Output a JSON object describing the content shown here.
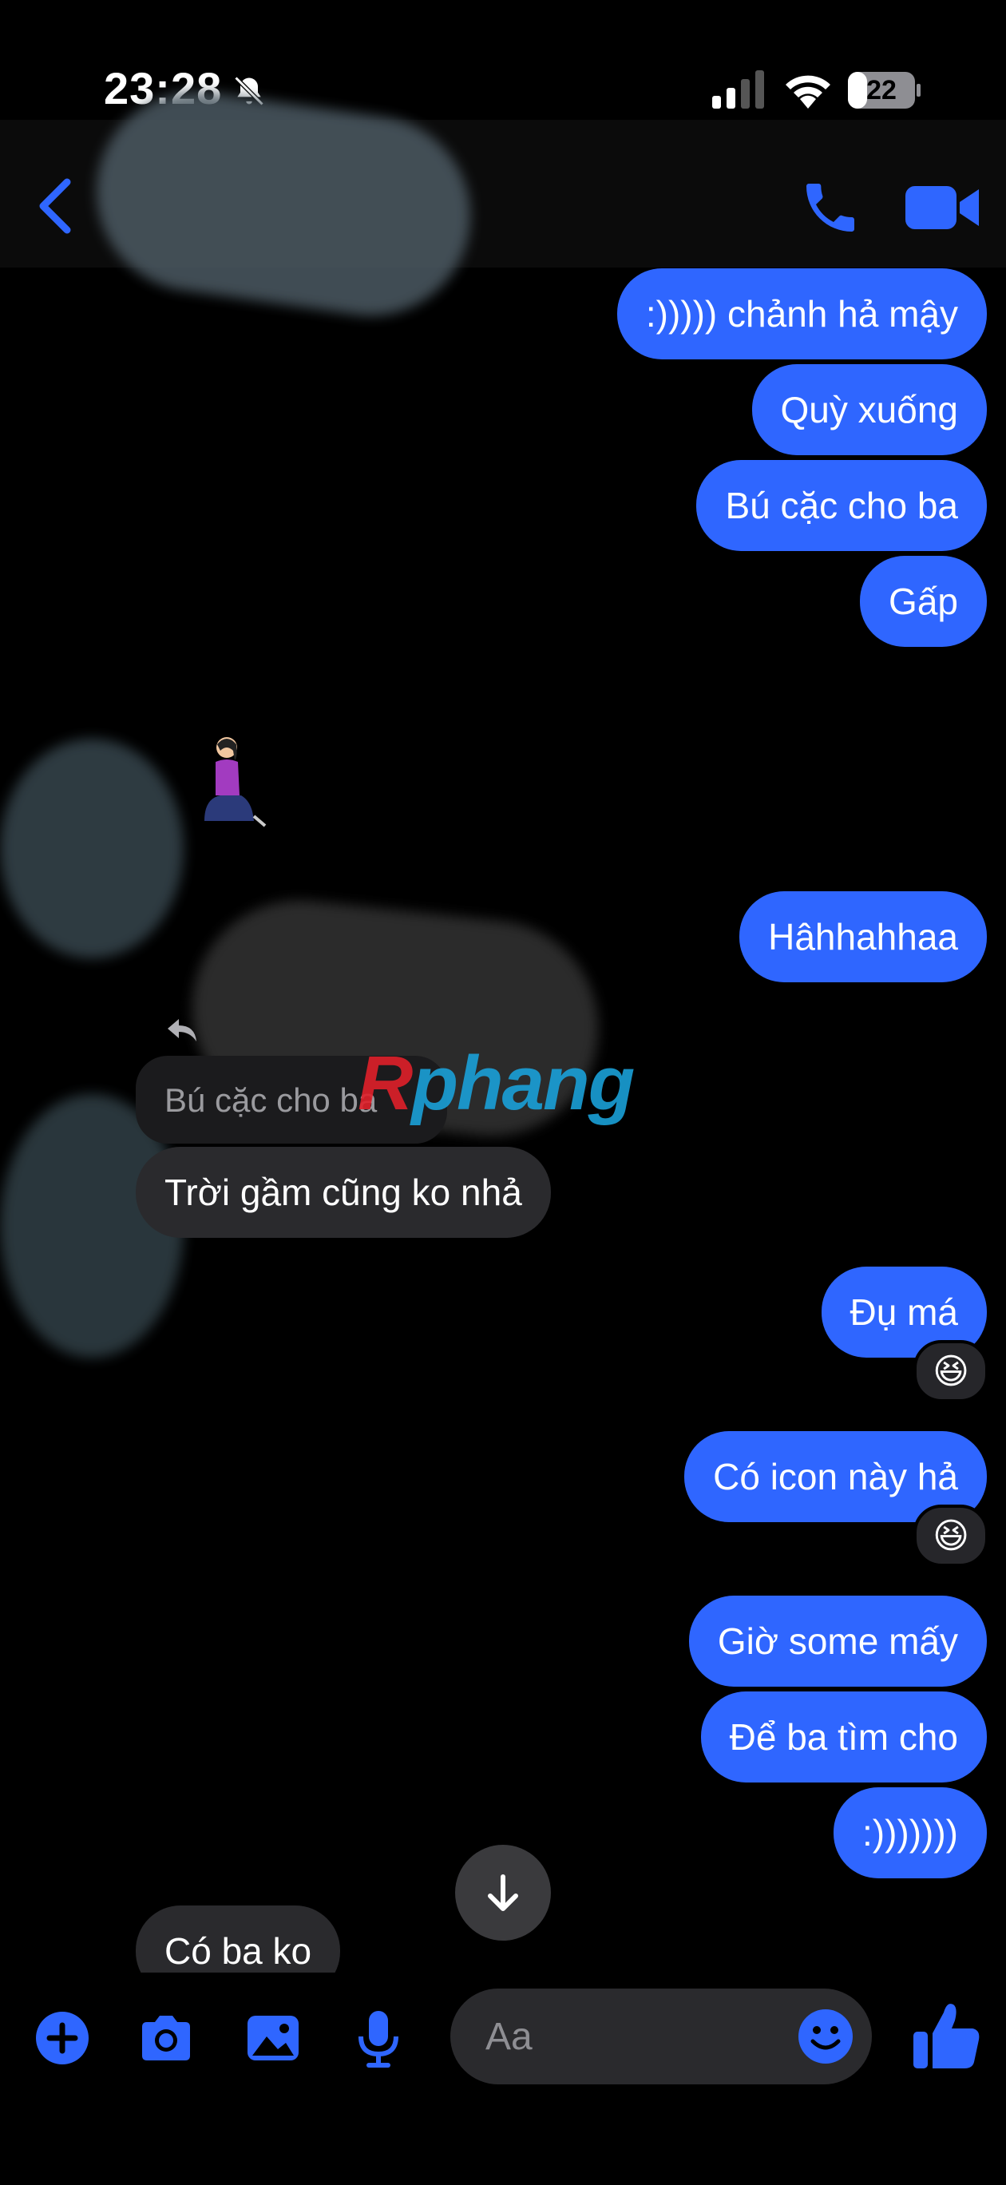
{
  "status_bar": {
    "time": "23:28",
    "battery": "22"
  },
  "messages": [
    {
      "dir": "out",
      "text": ":))))) chảnh hả mậy"
    },
    {
      "dir": "out",
      "text": "Quỳ xuống"
    },
    {
      "dir": "out",
      "text": "Bú cặc cho ba"
    },
    {
      "dir": "out",
      "text": "Gấp"
    },
    {
      "dir": "out",
      "text": "Hâhhahhaa"
    },
    {
      "dir": "in",
      "reply_to": "Bú cặc cho ba",
      "text": "Trời gầm cũng ko nhả"
    },
    {
      "dir": "out",
      "text": "Đụ má",
      "reaction": "😆"
    },
    {
      "dir": "out",
      "text": "Có icon này hả",
      "reaction": "😆"
    },
    {
      "dir": "out",
      "text": "Giờ some mấy"
    },
    {
      "dir": "out",
      "text": "Để ba tìm cho"
    },
    {
      "dir": "out",
      "text": ":)))))))"
    },
    {
      "dir": "in",
      "text": "Có ba ko"
    }
  ],
  "watermark": {
    "first": "R",
    "rest": "phang"
  },
  "composer": {
    "placeholder": "Aa"
  },
  "colors": {
    "accent": "#2f66ff",
    "incoming": "#2a2a2d"
  }
}
